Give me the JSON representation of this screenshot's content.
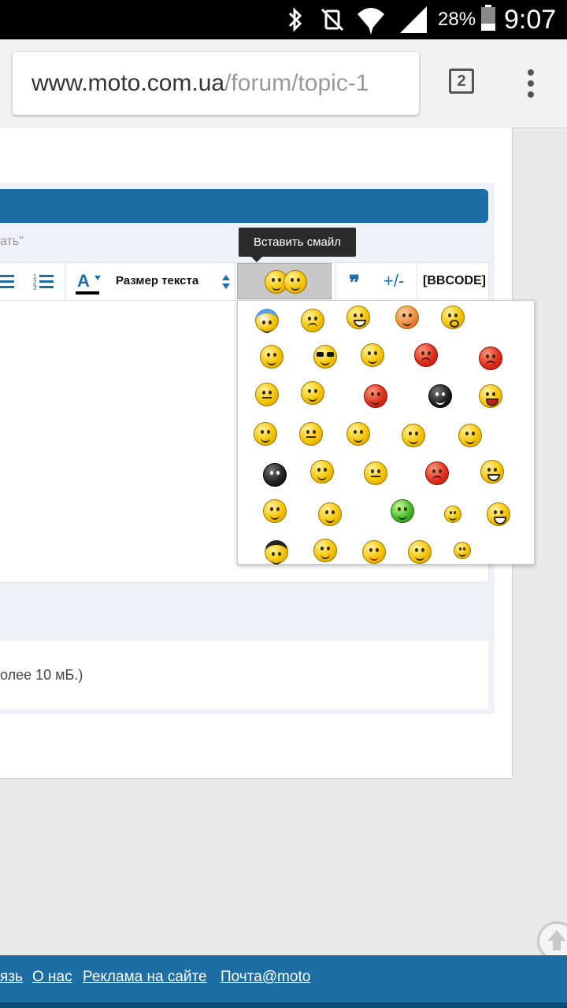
{
  "status_bar": {
    "battery": "28%",
    "time": "9:07",
    "icons": [
      "bluetooth-icon",
      "vibrate-mute-icon",
      "wifi-icon",
      "signal-icon",
      "battery-icon"
    ]
  },
  "browser": {
    "url_domain": "www.moto.com.ua",
    "url_path": "/forum/topic-1",
    "tab_count": "2"
  },
  "form": {
    "hint_text": "ать\"",
    "toolbar": {
      "text_size_label": "Размер текста",
      "quote_label": "❞",
      "plusminus_label": "+/-",
      "bbcode_label": "[BBCODE]"
    },
    "tooltip": "Вставить смайл",
    "attach_text": "олее 10 мБ.)"
  },
  "smiley_panel": {
    "rows": [
      [
        "smiley-blue-hat",
        "smiley-sad",
        "smiley-grin",
        "smiley-blush",
        "smiley-shocked"
      ],
      [
        "smiley-hug",
        "smiley-cool",
        "smiley-wall",
        "smiley-angry-red",
        "smiley-rage-red"
      ],
      [
        "smiley-bored",
        "smiley-crazy",
        "smiley-devil",
        "smiley-dark-devil",
        "smiley-laugh"
      ],
      [
        "smiley-angel",
        "smiley-neutral",
        "smiley-thumbs-up",
        "smiley-wave",
        "smiley-beer"
      ],
      [
        "smiley-bomb",
        "smiley-nerd",
        "smiley-thinking",
        "smiley-mad-red",
        "smiley-teeth"
      ],
      [
        "smiley-clap",
        "smiley-ruler",
        "smiley-green-sick",
        "smiley-small",
        "smiley-scared"
      ],
      [
        "smiley-mafia",
        "smiley-king",
        "smiley-drunk",
        "smiley-confused",
        "smiley-hurt"
      ]
    ]
  },
  "footer": {
    "links": [
      "язь",
      "О нас",
      "Реклама на сайте",
      "Почта@moto"
    ]
  },
  "colors": {
    "accent": "#1c6ea4",
    "status_bar": "#000000",
    "tooltip_bg": "#2b2b2b"
  }
}
